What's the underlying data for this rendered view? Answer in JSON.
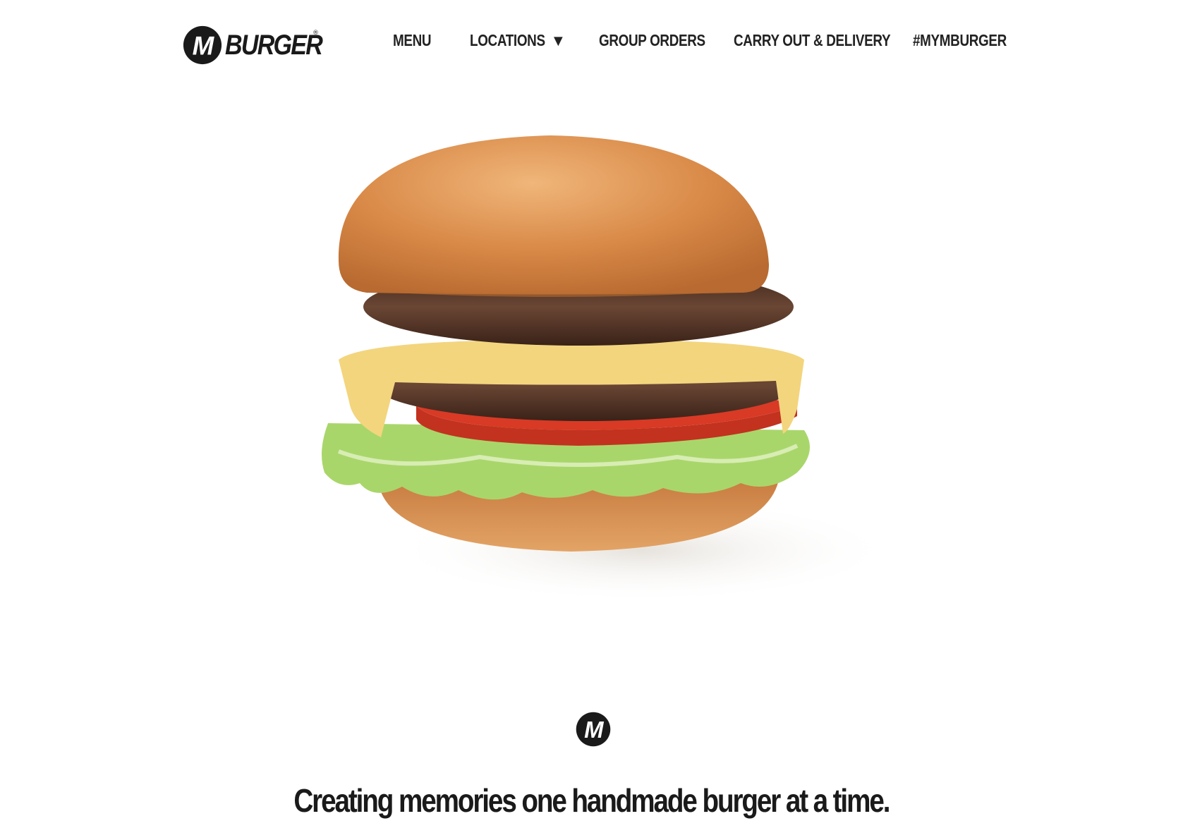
{
  "header": {
    "logo_text": "BURGER",
    "logo_letter": "M",
    "logo_reg": "®"
  },
  "nav": {
    "items": [
      {
        "label": "MENU",
        "icon": null
      },
      {
        "label": "LOCATIONS",
        "icon": "caret-down-icon"
      },
      {
        "label": "GROUP ORDERS",
        "icon": null
      },
      {
        "label": "CARRY OUT & DELIVERY",
        "icon": null
      },
      {
        "label": "#MYMBURGER",
        "icon": null
      }
    ],
    "caret_glyph": "▼"
  },
  "hero": {
    "image": "double-cheeseburger"
  },
  "footer": {
    "tagline": "Creating memories one handmade burger at a time."
  },
  "colors": {
    "text": "#1a1a1a",
    "background": "#ffffff",
    "bun": "#d9904e",
    "patty": "#5a3a2a",
    "cheese": "#f3d57e",
    "tomato": "#d83a26",
    "lettuce": "#a9d66a"
  }
}
